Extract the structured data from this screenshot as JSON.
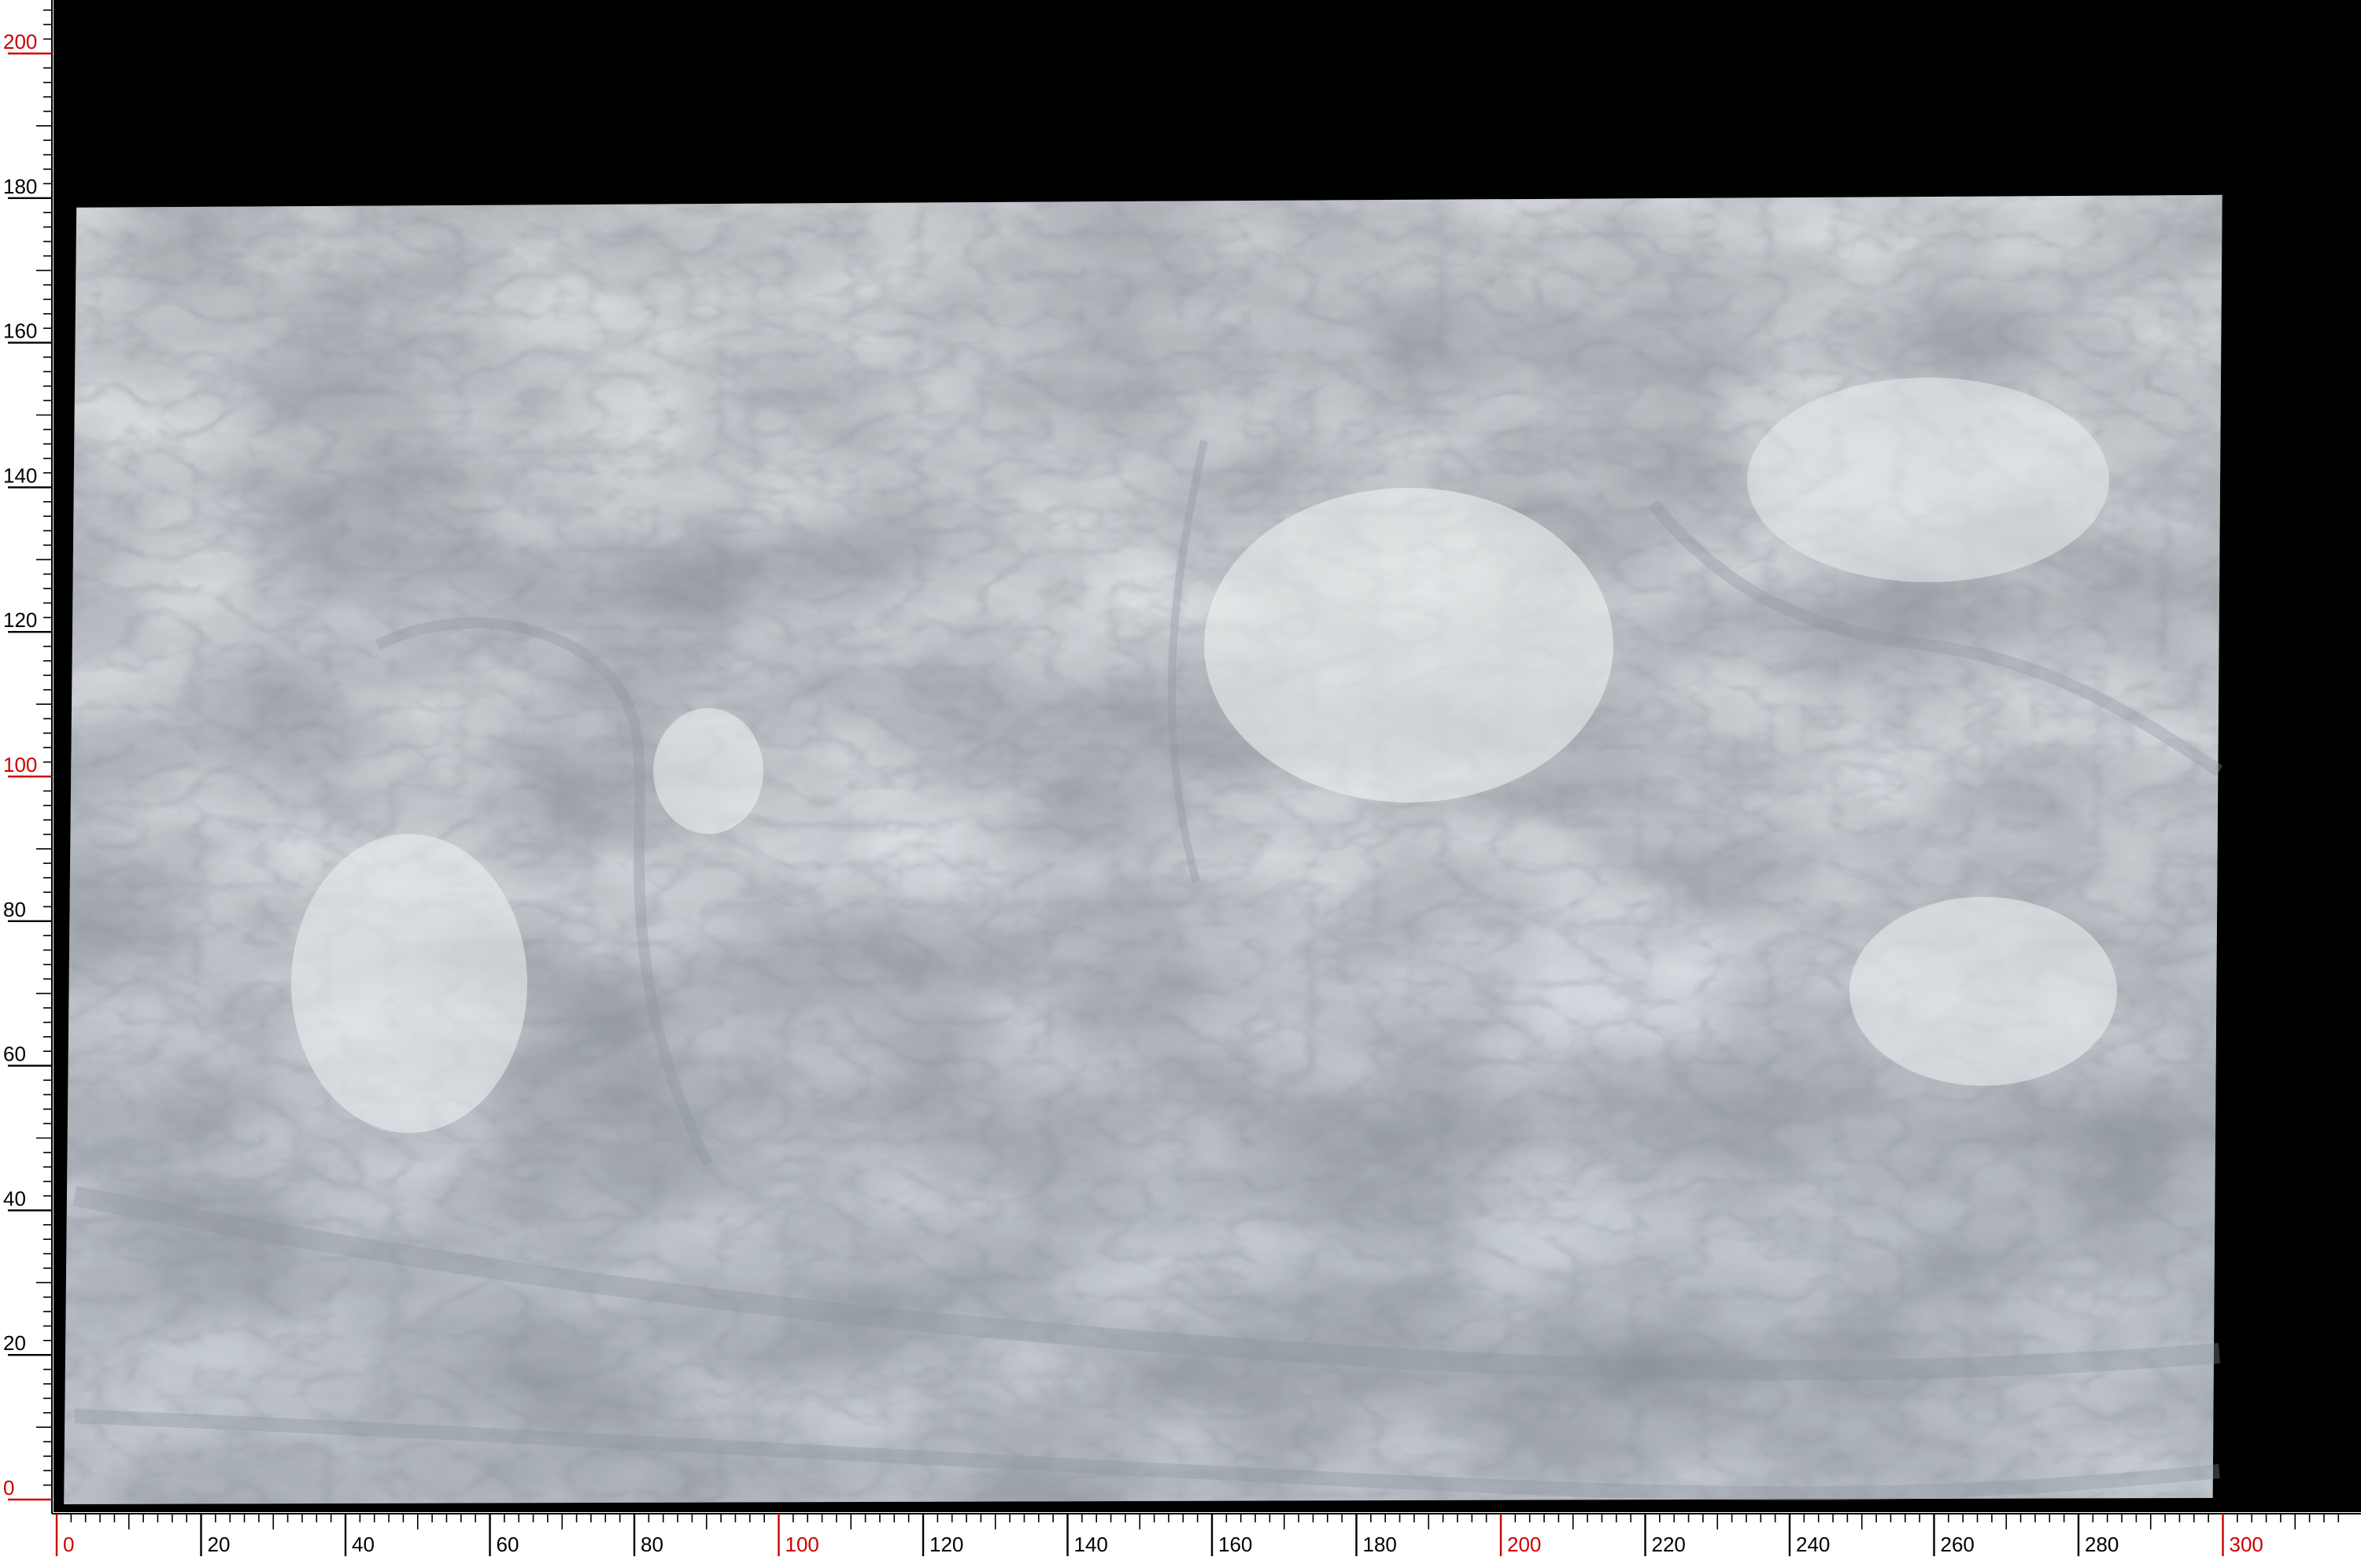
{
  "image": {
    "subject": "marble-slab",
    "background_color": "#000000",
    "ruler_color": "#ffffff",
    "tick_color_regular": "#000000",
    "tick_color_major": "#cc0000",
    "slab_base_color": "#d9dde2"
  },
  "ruler": {
    "unit_step_minor": 2,
    "unit_step_label": 20,
    "x_labels": [
      "0",
      "20",
      "40",
      "60",
      "80",
      "100",
      "120",
      "140",
      "160",
      "180",
      "200",
      "220",
      "240",
      "260",
      "280",
      "300"
    ],
    "x_major_red": [
      "0",
      "100",
      "200",
      "300"
    ],
    "y_labels": [
      "0",
      "20",
      "40",
      "60",
      "80",
      "100",
      "120",
      "140",
      "160",
      "180",
      "200"
    ],
    "y_major_red": [
      "0",
      "100",
      "200"
    ],
    "x_range": [
      0,
      317
    ],
    "y_range": [
      0,
      208
    ],
    "slab_extent": {
      "x": [
        1,
        301
      ],
      "y": [
        0,
        180
      ]
    }
  }
}
